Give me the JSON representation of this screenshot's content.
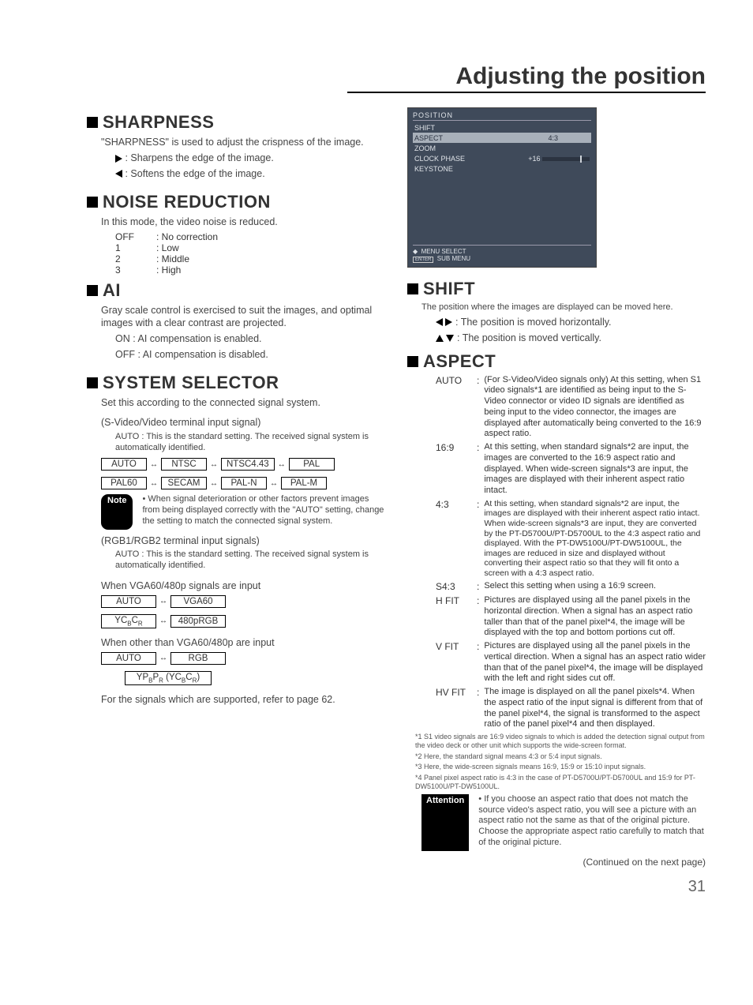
{
  "page": {
    "title": "Adjusting the position",
    "number": "31",
    "continued": "(Continued on the next page)"
  },
  "left": {
    "sharpness": {
      "title": "SHARPNESS",
      "body": "\"SHARPNESS\" is used to adjust the crispness of the image.",
      "right": ": Sharpens the edge of the image.",
      "left": ": Softens the edge of the image."
    },
    "noise": {
      "title": "NOISE REDUCTION",
      "body": "In this mode, the video noise is reduced.",
      "opts": [
        {
          "k": "OFF",
          "v": ": No correction"
        },
        {
          "k": "1",
          "v": ": Low"
        },
        {
          "k": "2",
          "v": ": Middle"
        },
        {
          "k": "3",
          "v": ": High"
        }
      ]
    },
    "ai": {
      "title": "AI",
      "body": "Gray scale control is exercised to suit the images, and optimal images with a clear contrast are projected.",
      "on": "ON   : AI compensation is enabled.",
      "off": "OFF : AI compensation is disabled."
    },
    "sys": {
      "title": "SYSTEM SELECTOR",
      "body": "Set this according to the connected signal system.",
      "sv_label": "(S-Video/Video terminal input signal)",
      "auto": "AUTO : This is the standard setting. The received signal system is automatically identified.",
      "row1": [
        "AUTO",
        "NTSC",
        "NTSC4.43",
        "PAL"
      ],
      "row2": [
        "PAL60",
        "SECAM",
        "PAL-N",
        "PAL-M"
      ],
      "note_label": "Note",
      "note": "When signal deterioration or other factors prevent images from being displayed correctly with the \"AUTO\" setting, change the setting to match the connected signal system.",
      "rgb_label": "(RGB1/RGB2 terminal input signals)",
      "auto2": "AUTO : This is the standard setting. The received signal system is automatically identified.",
      "vga_label": "When VGA60/480p signals are input",
      "vga_r1": [
        "AUTO",
        "VGA60"
      ],
      "vga_r2": [
        "YCBCR",
        "480pRGB"
      ],
      "other_label": "When other than VGA60/480p are input",
      "other_r1": [
        "AUTO",
        "RGB"
      ],
      "other_r2": "YPBPR (YCBCR)",
      "ref": "For the signals which are supported, refer to page 62."
    }
  },
  "right": {
    "osd": {
      "title": "POSITION",
      "rows": [
        {
          "l": "SHIFT",
          "r": ""
        },
        {
          "l": "ASPECT",
          "r": "4:3"
        },
        {
          "l": "ZOOM",
          "r": ""
        },
        {
          "l": "CLOCK PHASE",
          "r": "+16"
        },
        {
          "l": "KEYSTONE",
          "r": ""
        }
      ],
      "foot1": "MENU SELECT",
      "foot2": "SUB MENU"
    },
    "shift": {
      "title": "SHIFT",
      "body": "The position where the images are displayed can be moved here.",
      "h": ": The position is moved horizontally.",
      "v": ": The position is moved vertically."
    },
    "aspect": {
      "title": "ASPECT",
      "items": [
        {
          "k": "AUTO",
          "v": "(For S-Video/Video signals only) At this setting, when S1 video signals*1 are identified as being input to the S-Video connector or video ID signals are identified as being input to the video connector, the images are displayed after automatically being converted to the 16:9 aspect ratio."
        },
        {
          "k": "16:9",
          "v": "At this setting, when standard signals*2 are input, the images are converted to the 16:9 aspect ratio and displayed. When wide-screen signals*3 are input, the images are displayed with their inherent aspect ratio intact."
        },
        {
          "k": "4:3",
          "v": "At this setting, when standard signals*2 are input, the images are displayed with their inherent aspect ratio intact. When wide-screen signals*3 are input, they are converted by the PT-D5700U/PT-D5700UL to the 4:3 aspect ratio and displayed. With the PT-DW5100U/PT-DW5100UL, the images are reduced in size and displayed without converting their aspect ratio so that they will fit onto a screen with a 4:3 aspect ratio."
        },
        {
          "k": "S4:3",
          "v": "Select this setting when using a 16:9 screen."
        },
        {
          "k": "H FIT",
          "v": "Pictures are displayed using all the panel pixels in the horizontal direction. When a signal has an aspect ratio taller than that of the panel pixel*4, the image will be displayed with the top and bottom portions cut off."
        },
        {
          "k": "V FIT",
          "v": "Pictures are displayed using all the panel pixels in the vertical direction. When a signal has an aspect ratio wider than that of the panel pixel*4, the image will be displayed with the left and right sides cut off."
        },
        {
          "k": "HV FIT",
          "v": "The image is displayed on all the panel pixels*4. When the aspect ratio of the input signal is different from that of the panel pixel*4, the signal is transformed to the aspect ratio of the panel pixel*4 and then displayed."
        }
      ],
      "footnotes": [
        "*1 S1 video signals are 16:9 video signals to which is added the detection signal output from the video deck or other unit which supports the wide-screen format.",
        "*2 Here, the standard signal means 4:3 or 5:4 input signals.",
        "*3 Here, the wide-screen signals means 16:9, 15:9 or 15:10 input signals.",
        "*4 Panel pixel aspect ratio is 4:3 in the case of PT-D5700U/PT-D5700UL and 15:9 for PT-DW5100U/PT-DW5100UL."
      ],
      "attn_label": "Attention",
      "attn": "If you choose an aspect ratio that does not match the source video's aspect ratio, you will see a picture with an aspect ratio not the same as that of the original picture. Choose the appropriate aspect ratio carefully to match that of the original picture."
    }
  }
}
